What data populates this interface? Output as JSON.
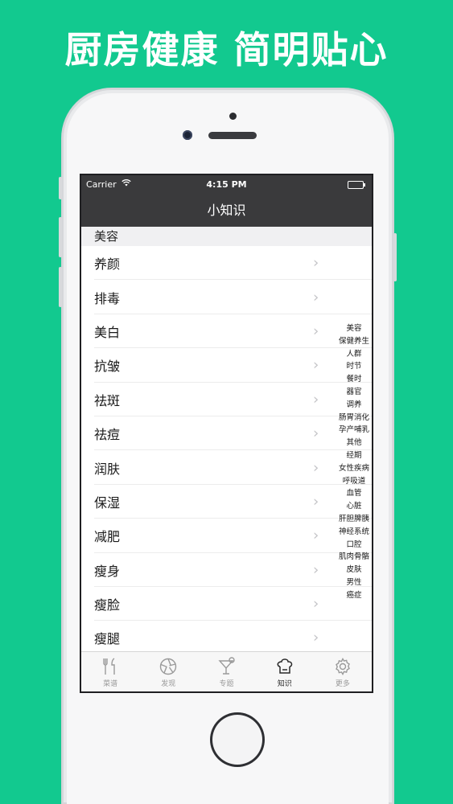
{
  "headline": "厨房健康 简明贴心",
  "status_bar": {
    "carrier": "Carrier",
    "time": "4:15 PM"
  },
  "nav": {
    "title": "小知识"
  },
  "section": {
    "title": "美容"
  },
  "list_items": [
    "养颜",
    "排毒",
    "美白",
    "抗皱",
    "祛斑",
    "祛痘",
    "润肤",
    "保湿",
    "减肥",
    "瘦身",
    "瘦脸",
    "瘦腿"
  ],
  "index_items": [
    "美容",
    "保健养生",
    "人群",
    "时节",
    "餐时",
    "器官",
    "调养",
    "肠胃消化",
    "孕产哺乳",
    "其他",
    "经期",
    "女性疾病",
    "呼吸道",
    "血管",
    "心脏",
    "肝胆脾胰",
    "神经系统",
    "口腔",
    "肌肉骨骼",
    "皮肤",
    "男性",
    "癌症"
  ],
  "tabs": [
    {
      "label": "菜谱",
      "icon": "fork-knife-icon",
      "active": false
    },
    {
      "label": "发现",
      "icon": "aperture-icon",
      "active": false
    },
    {
      "label": "专题",
      "icon": "cocktail-icon",
      "active": false
    },
    {
      "label": "知识",
      "icon": "chef-hat-icon",
      "active": true
    },
    {
      "label": "更多",
      "icon": "gear-icon",
      "active": false
    }
  ],
  "colors": {
    "background": "#12c98f",
    "bar": "#3a3a3c",
    "active_tab": "#2a2a2a",
    "inactive_tab": "#9a9a9a"
  }
}
